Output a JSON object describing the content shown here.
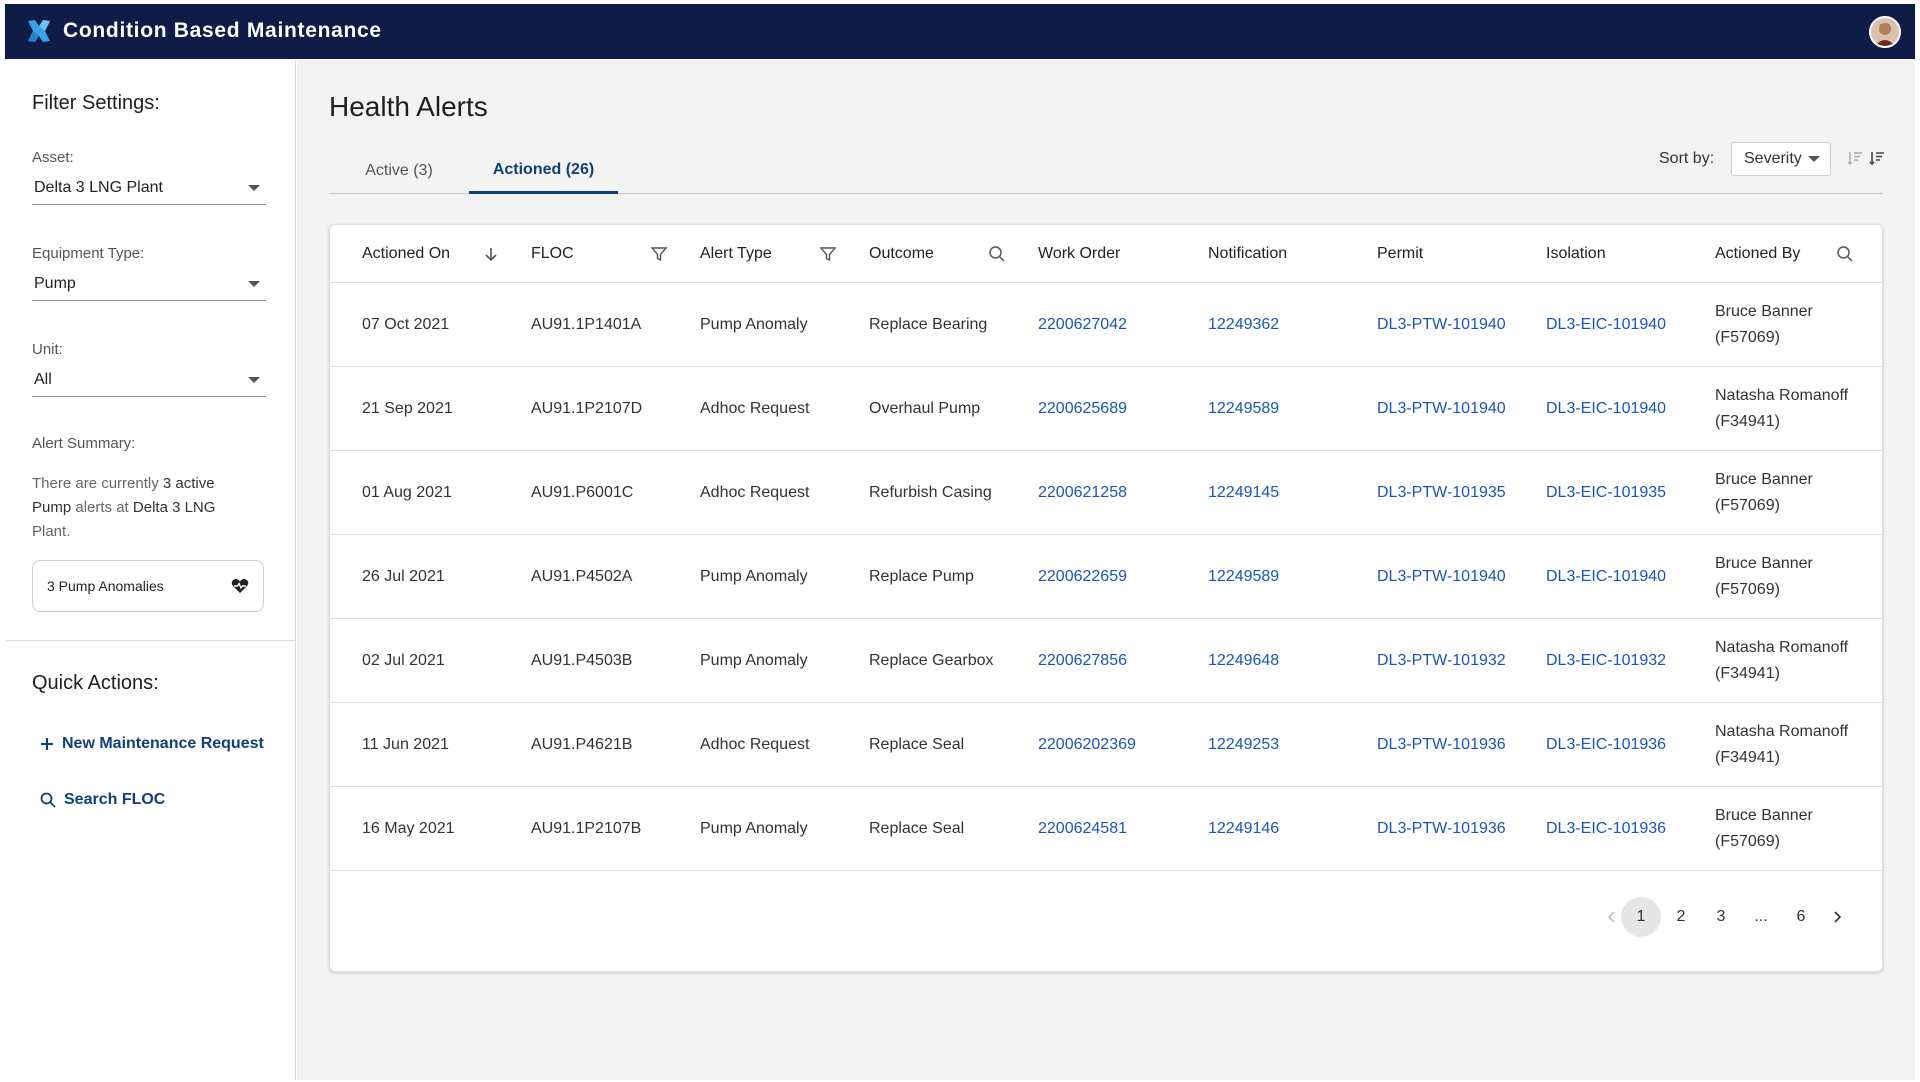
{
  "app": {
    "title": "Condition Based Maintenance"
  },
  "sidebar": {
    "filter_title": "Filter Settings:",
    "asset_label": "Asset:",
    "asset_value": "Delta 3 LNG Plant",
    "equipment_label": "Equipment Type:",
    "equipment_value": "Pump",
    "unit_label": "Unit:",
    "unit_value": "All",
    "summary_label": "Alert Summary:",
    "summary_pre": "There are currently ",
    "summary_count": "3 active",
    "summary_mid": " ",
    "summary_equip": "Pump",
    "summary_mid2": " alerts at ",
    "summary_site": "Delta 3 LNG",
    "summary_post": " Plant.",
    "chip_label": "3 Pump Anomalies",
    "quick_title": "Quick Actions:",
    "quick_new": "New Maintenance Request",
    "quick_search": "Search FLOC"
  },
  "main": {
    "title": "Health Alerts",
    "tabs": [
      {
        "label": "Active (3)"
      },
      {
        "label": "Actioned (26)"
      }
    ],
    "sort_label": "Sort by:",
    "sort_value": "Severity"
  },
  "table": {
    "headers": [
      "Actioned On",
      "FLOC",
      "Alert Type",
      "Outcome",
      "Work Order",
      "Notification",
      "Permit",
      "Isolation",
      "Actioned By"
    ],
    "rows": [
      {
        "date": "07 Oct 2021",
        "floc": "AU91.1P1401A",
        "type": "Pump Anomaly",
        "outcome": "Replace Bearing",
        "wo": "2200627042",
        "notif": "12249362",
        "permit": "DL3-PTW-101940",
        "iso": "DL3-EIC-101940",
        "by": "Bruce Banner",
        "by_id": "(F57069)"
      },
      {
        "date": "21 Sep 2021",
        "floc": "AU91.1P2107D",
        "type": "Adhoc Request",
        "outcome": "Overhaul Pump",
        "wo": "2200625689",
        "notif": "12249589",
        "permit": "DL3-PTW-101940",
        "iso": "DL3-EIC-101940",
        "by": "Natasha Romanoff",
        "by_id": "(F34941)"
      },
      {
        "date": "01 Aug 2021",
        "floc": "AU91.P6001C",
        "type": "Adhoc Request",
        "outcome": "Refurbish Casing",
        "wo": "2200621258",
        "notif": "12249145",
        "permit": "DL3-PTW-101935",
        "iso": "DL3-EIC-101935",
        "by": "Bruce Banner",
        "by_id": "(F57069)"
      },
      {
        "date": "26 Jul 2021",
        "floc": "AU91.P4502A",
        "type": "Pump Anomaly",
        "outcome": "Replace Pump",
        "wo": "2200622659",
        "notif": "12249589",
        "permit": "DL3-PTW-101940",
        "iso": "DL3-EIC-101940",
        "by": "Bruce Banner",
        "by_id": "(F57069)"
      },
      {
        "date": "02 Jul 2021",
        "floc": "AU91.P4503B",
        "type": "Pump Anomaly",
        "outcome": "Replace Gearbox",
        "wo": "2200627856",
        "notif": "12249648",
        "permit": "DL3-PTW-101932",
        "iso": "DL3-EIC-101932",
        "by": "Natasha Romanoff",
        "by_id": "(F34941)"
      },
      {
        "date": "11 Jun 2021",
        "floc": "AU91.P4621B",
        "type": "Adhoc Request",
        "outcome": "Replace Seal",
        "wo": "22006202369",
        "notif": "12249253",
        "permit": "DL3-PTW-101936",
        "iso": "DL3-EIC-101936",
        "by": "Natasha Romanoff",
        "by_id": "(F34941)"
      },
      {
        "date": "16 May 2021",
        "floc": "AU91.1P2107B",
        "type": "Pump Anomaly",
        "outcome": "Replace Seal",
        "wo": "2200624581",
        "notif": "12249146",
        "permit": "DL3-PTW-101936",
        "iso": "DL3-EIC-101936",
        "by": "Bruce Banner",
        "by_id": "(F57069)"
      }
    ]
  },
  "pagination": {
    "pages": [
      "1",
      "2",
      "3",
      "...",
      "6"
    ],
    "current": "1"
  },
  "icons": {
    "logo": "cross-logo-icon",
    "sort_asc": "sort-ascending-icon",
    "sort_desc": "sort-descending-icon",
    "heart": "heart-pulse-icon"
  },
  "colors": {
    "header_bg": "#0e1c47",
    "accent": "#123f7a",
    "link": "#1a56b6"
  }
}
